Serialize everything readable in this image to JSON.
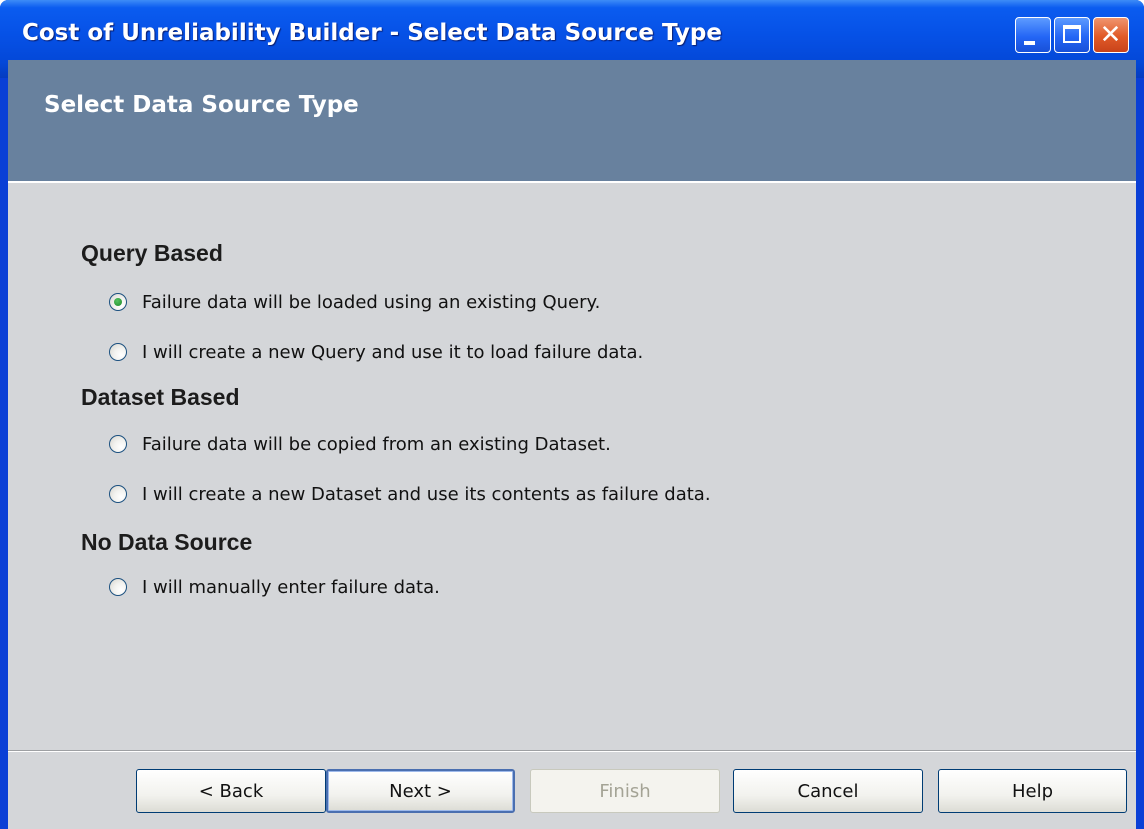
{
  "window": {
    "title": "Cost of Unreliability Builder - Select Data Source Type",
    "controls": {
      "minimize": "minimize-icon",
      "maximize": "maximize-icon",
      "close": "close-icon"
    }
  },
  "header": {
    "title": "Select Data Source Type"
  },
  "sections": [
    {
      "heading": "Query Based",
      "options": [
        {
          "label": "Failure data will be loaded using an existing Query.",
          "selected": true
        },
        {
          "label": "I will create a new Query and use it to load failure data.",
          "selected": false
        }
      ]
    },
    {
      "heading": "Dataset Based",
      "options": [
        {
          "label": "Failure data will be copied from an existing Dataset.",
          "selected": false
        },
        {
          "label": "I will create a new Dataset and use its contents as failure data.",
          "selected": false
        }
      ]
    },
    {
      "heading": "No Data Source",
      "options": [
        {
          "label": "I will manually enter failure data.",
          "selected": false
        }
      ]
    }
  ],
  "buttons": {
    "back": "< Back",
    "next": "Next >",
    "finish": "Finish",
    "cancel": "Cancel",
    "help": "Help"
  },
  "colors": {
    "title_bar": "#0651e6",
    "header_band": "#68819e",
    "client_bg": "#d4d6d9"
  }
}
